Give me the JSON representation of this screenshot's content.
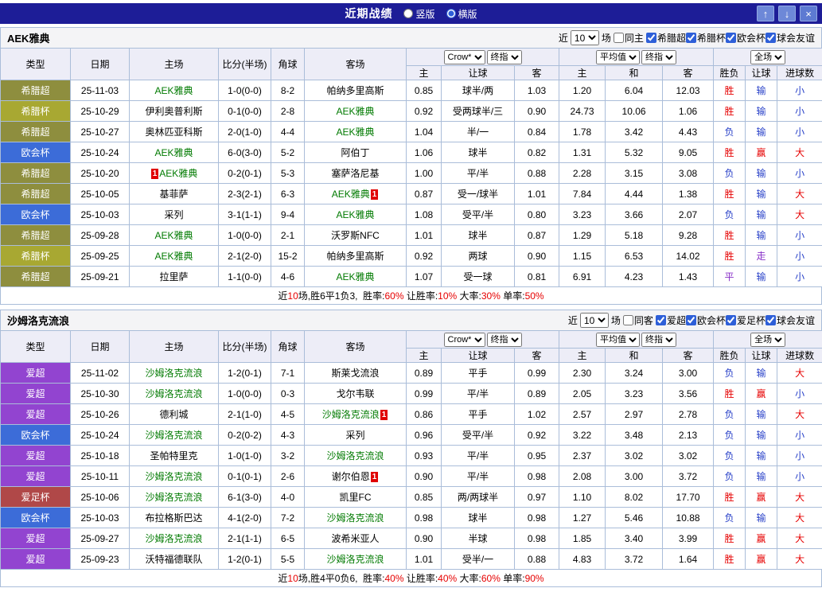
{
  "titlebar": {
    "title": "近期战绩",
    "radios": [
      {
        "label": "竖版",
        "selected": false
      },
      {
        "label": "横版",
        "selected": true
      }
    ],
    "buttons": {
      "up": "↑",
      "down": "↓",
      "close": "×"
    }
  },
  "league_colors": {
    "希腊超": "#8e8e3e",
    "希腊杯": "#a8a832",
    "欧会杯": "#3c6cd8",
    "爱超": "#9244d0",
    "爱足杯": "#b04848"
  },
  "result_colors": {
    "胜": "#e60000",
    "负": "#2840c8",
    "平": "#8830c8",
    "赢": "#e60000",
    "输": "#2840c8",
    "走": "#8830c8",
    "大": "#e60000",
    "小": "#2840c8"
  },
  "table": {
    "left_headers": [
      "类型",
      "日期",
      "主场",
      "比分(半场)",
      "角球",
      "客场"
    ],
    "group1": {
      "select1": "Crow*",
      "select2": "终指",
      "cols": [
        "主",
        "让球",
        "客"
      ]
    },
    "group2": {
      "select1": "平均值",
      "select2": "终指",
      "cols": [
        "主",
        "和",
        "客"
      ]
    },
    "group3": {
      "select": "全场",
      "cols": [
        "胜负",
        "让球",
        "进球数"
      ]
    }
  },
  "sections": [
    {
      "team": "AEK雅典",
      "near_label": "近",
      "count": "10",
      "games_label": "场",
      "same": {
        "label": "同主",
        "checked": false
      },
      "filters": [
        {
          "label": "希腊超",
          "checked": true
        },
        {
          "label": "希腊杯",
          "checked": true
        },
        {
          "label": "欧会杯",
          "checked": true
        },
        {
          "label": "球会友谊",
          "checked": true
        }
      ],
      "rows": [
        {
          "lg": "希腊超",
          "dt": "25-11-03",
          "hm": "AEK雅典",
          "hmT": true,
          "sc": "1-0(0-0)",
          "cn": "8-2",
          "aw": "帕纳多里高斯",
          "o": [
            "0.85",
            "球半/两",
            "1.03"
          ],
          "avg": [
            "1.20",
            "6.04",
            "12.03"
          ],
          "rs": [
            "胜",
            "输",
            "小"
          ]
        },
        {
          "lg": "希腊杯",
          "dt": "25-10-29",
          "hm": "伊利奥普利斯",
          "sc": "0-1(0-0)",
          "cn": "2-8",
          "aw": "AEK雅典",
          "awT": true,
          "o": [
            "0.92",
            "受两球半/三",
            "0.90"
          ],
          "avg": [
            "24.73",
            "10.06",
            "1.06"
          ],
          "rs": [
            "胜",
            "输",
            "小"
          ]
        },
        {
          "lg": "希腊超",
          "dt": "25-10-27",
          "hm": "奥林匹亚科斯",
          "sc": "2-0(1-0)",
          "cn": "4-4",
          "aw": "AEK雅典",
          "awT": true,
          "o": [
            "1.04",
            "半/一",
            "0.84"
          ],
          "avg": [
            "1.78",
            "3.42",
            "4.43"
          ],
          "rs": [
            "负",
            "输",
            "小"
          ]
        },
        {
          "lg": "欧会杯",
          "dt": "25-10-24",
          "hm": "AEK雅典",
          "hmT": true,
          "sc": "6-0(3-0)",
          "cn": "5-2",
          "aw": "阿伯丁",
          "o": [
            "1.06",
            "球半",
            "0.82"
          ],
          "avg": [
            "1.31",
            "5.32",
            "9.05"
          ],
          "rs": [
            "胜",
            "赢",
            "大"
          ]
        },
        {
          "lg": "希腊超",
          "dt": "25-10-20",
          "hm": "AEK雅典",
          "hmT": true,
          "hmB": "1",
          "sc": "0-2(0-1)",
          "cn": "5-3",
          "aw": "塞萨洛尼基",
          "o": [
            "1.00",
            "平/半",
            "0.88"
          ],
          "avg": [
            "2.28",
            "3.15",
            "3.08"
          ],
          "rs": [
            "负",
            "输",
            "小"
          ]
        },
        {
          "lg": "希腊超",
          "dt": "25-10-05",
          "hm": "基菲萨",
          "sc": "2-3(2-1)",
          "cn": "6-3",
          "aw": "AEK雅典",
          "awT": true,
          "awB": "1",
          "o": [
            "0.87",
            "受一/球半",
            "1.01"
          ],
          "avg": [
            "7.84",
            "4.44",
            "1.38"
          ],
          "rs": [
            "胜",
            "输",
            "大"
          ]
        },
        {
          "lg": "欧会杯",
          "dt": "25-10-03",
          "hm": "采列",
          "sc": "3-1(1-1)",
          "cn": "9-4",
          "aw": "AEK雅典",
          "awT": true,
          "o": [
            "1.08",
            "受平/半",
            "0.80"
          ],
          "avg": [
            "3.23",
            "3.66",
            "2.07"
          ],
          "rs": [
            "负",
            "输",
            "大"
          ]
        },
        {
          "lg": "希腊超",
          "dt": "25-09-28",
          "hm": "AEK雅典",
          "hmT": true,
          "sc": "1-0(0-0)",
          "cn": "2-1",
          "aw": "沃罗斯NFC",
          "o": [
            "1.01",
            "球半",
            "0.87"
          ],
          "avg": [
            "1.29",
            "5.18",
            "9.28"
          ],
          "rs": [
            "胜",
            "输",
            "小"
          ]
        },
        {
          "lg": "希腊杯",
          "dt": "25-09-25",
          "hm": "AEK雅典",
          "hmT": true,
          "sc": "2-1(2-0)",
          "cn": "15-2",
          "aw": "帕纳多里高斯",
          "o": [
            "0.92",
            "两球",
            "0.90"
          ],
          "avg": [
            "1.15",
            "6.53",
            "14.02"
          ],
          "rs": [
            "胜",
            "走",
            "小"
          ]
        },
        {
          "lg": "希腊超",
          "dt": "25-09-21",
          "hm": "拉里萨",
          "sc": "1-1(0-0)",
          "cn": "4-6",
          "aw": "AEK雅典",
          "awT": true,
          "o": [
            "1.07",
            "受一球",
            "0.81"
          ],
          "avg": [
            "6.91",
            "4.23",
            "1.43"
          ],
          "rs": [
            "平",
            "输",
            "小"
          ]
        }
      ],
      "summary": {
        "lead": "近",
        "count": "10",
        "tail": "场,胜6平1负3,",
        "stats": [
          [
            "胜率:",
            "60%"
          ],
          [
            "让胜率:",
            "10%"
          ],
          [
            "大率:",
            "30%"
          ],
          [
            "单率:",
            "50%"
          ]
        ]
      }
    },
    {
      "team": "沙姆洛克流浪",
      "near_label": "近",
      "count": "10",
      "games_label": "场",
      "same": {
        "label": "同客",
        "checked": false
      },
      "filters": [
        {
          "label": "爱超",
          "checked": true
        },
        {
          "label": "欧会杯",
          "checked": true
        },
        {
          "label": "爱足杯",
          "checked": true
        },
        {
          "label": "球会友谊",
          "checked": true
        }
      ],
      "rows": [
        {
          "lg": "爱超",
          "dt": "25-11-02",
          "hm": "沙姆洛克流浪",
          "hmT": true,
          "sc": "1-2(0-1)",
          "cn": "7-1",
          "aw": "斯莱戈流浪",
          "o": [
            "0.89",
            "平手",
            "0.99"
          ],
          "avg": [
            "2.30",
            "3.24",
            "3.00"
          ],
          "rs": [
            "负",
            "输",
            "大"
          ]
        },
        {
          "lg": "爱超",
          "dt": "25-10-30",
          "hm": "沙姆洛克流浪",
          "hmT": true,
          "sc": "1-0(0-0)",
          "cn": "0-3",
          "aw": "戈尔韦联",
          "o": [
            "0.99",
            "平/半",
            "0.89"
          ],
          "avg": [
            "2.05",
            "3.23",
            "3.56"
          ],
          "rs": [
            "胜",
            "赢",
            "小"
          ]
        },
        {
          "lg": "爱超",
          "dt": "25-10-26",
          "hm": "德利城",
          "sc": "2-1(1-0)",
          "cn": "4-5",
          "aw": "沙姆洛克流浪",
          "awT": true,
          "awB": "1",
          "o": [
            "0.86",
            "平手",
            "1.02"
          ],
          "avg": [
            "2.57",
            "2.97",
            "2.78"
          ],
          "rs": [
            "负",
            "输",
            "大"
          ]
        },
        {
          "lg": "欧会杯",
          "dt": "25-10-24",
          "hm": "沙姆洛克流浪",
          "hmT": true,
          "sc": "0-2(0-2)",
          "cn": "4-3",
          "aw": "采列",
          "o": [
            "0.96",
            "受平/半",
            "0.92"
          ],
          "avg": [
            "3.22",
            "3.48",
            "2.13"
          ],
          "rs": [
            "负",
            "输",
            "小"
          ]
        },
        {
          "lg": "爱超",
          "dt": "25-10-18",
          "hm": "圣帕特里克",
          "sc": "1-0(1-0)",
          "cn": "3-2",
          "aw": "沙姆洛克流浪",
          "awT": true,
          "o": [
            "0.93",
            "平/半",
            "0.95"
          ],
          "avg": [
            "2.37",
            "3.02",
            "3.02"
          ],
          "rs": [
            "负",
            "输",
            "小"
          ]
        },
        {
          "lg": "爱超",
          "dt": "25-10-11",
          "hm": "沙姆洛克流浪",
          "hmT": true,
          "sc": "0-1(0-1)",
          "cn": "2-6",
          "aw": "谢尔伯恩",
          "awB": "1",
          "o": [
            "0.90",
            "平/半",
            "0.98"
          ],
          "avg": [
            "2.08",
            "3.00",
            "3.72"
          ],
          "rs": [
            "负",
            "输",
            "小"
          ]
        },
        {
          "lg": "爱足杯",
          "dt": "25-10-06",
          "hm": "沙姆洛克流浪",
          "hmT": true,
          "sc": "6-1(3-0)",
          "cn": "4-0",
          "aw": "凯里FC",
          "o": [
            "0.85",
            "两/两球半",
            "0.97"
          ],
          "avg": [
            "1.10",
            "8.02",
            "17.70"
          ],
          "rs": [
            "胜",
            "赢",
            "大"
          ]
        },
        {
          "lg": "欧会杯",
          "dt": "25-10-03",
          "hm": "布拉格斯巴达",
          "sc": "4-1(2-0)",
          "cn": "7-2",
          "aw": "沙姆洛克流浪",
          "awT": true,
          "o": [
            "0.98",
            "球半",
            "0.98"
          ],
          "avg": [
            "1.27",
            "5.46",
            "10.88"
          ],
          "rs": [
            "负",
            "输",
            "大"
          ]
        },
        {
          "lg": "爱超",
          "dt": "25-09-27",
          "hm": "沙姆洛克流浪",
          "hmT": true,
          "sc": "2-1(1-1)",
          "cn": "6-5",
          "aw": "波希米亚人",
          "o": [
            "0.90",
            "半球",
            "0.98"
          ],
          "avg": [
            "1.85",
            "3.40",
            "3.99"
          ],
          "rs": [
            "胜",
            "赢",
            "大"
          ]
        },
        {
          "lg": "爱超",
          "dt": "25-09-23",
          "hm": "沃特福德联队",
          "sc": "1-2(0-1)",
          "cn": "5-5",
          "aw": "沙姆洛克流浪",
          "awT": true,
          "o": [
            "1.01",
            "受半/一",
            "0.88"
          ],
          "avg": [
            "4.83",
            "3.72",
            "1.64"
          ],
          "rs": [
            "胜",
            "赢",
            "大"
          ]
        }
      ],
      "summary": {
        "lead": "近",
        "count": "10",
        "tail": "场,胜4平0负6,",
        "stats": [
          [
            "胜率:",
            "40%"
          ],
          [
            "让胜率:",
            "40%"
          ],
          [
            "大率:",
            "60%"
          ],
          [
            "单率:",
            "90%"
          ]
        ]
      }
    }
  ]
}
